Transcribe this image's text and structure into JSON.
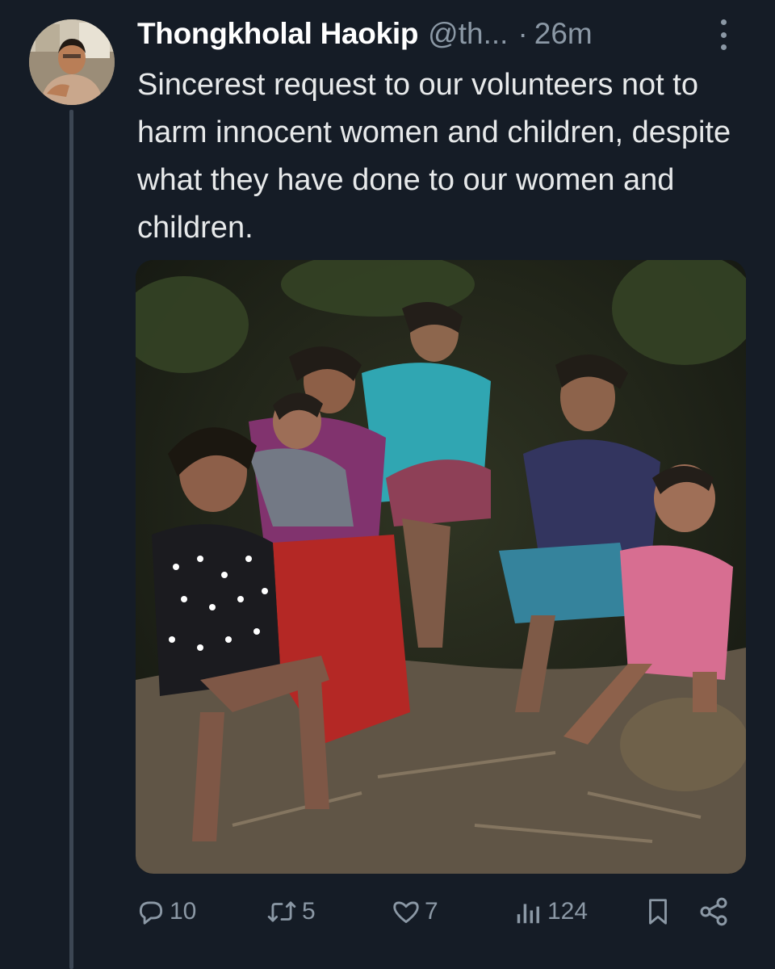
{
  "tweet": {
    "author_name": "Thongkholal Haokip",
    "handle": "@th...",
    "separator": "·",
    "time": "26m",
    "text": "Sincerest request to our volunteers not to harm innocent women and children, despite what they have done to our women and children."
  },
  "actions": {
    "replies": "10",
    "retweets": "5",
    "likes": "7",
    "views": "124"
  },
  "icons": [
    "more-icon",
    "reply-icon",
    "retweet-icon",
    "like-icon",
    "views-icon",
    "bookmark-icon",
    "share-icon"
  ],
  "colors": {
    "background": "#151c26",
    "text": "#e7e9ea",
    "muted": "#8b98a5"
  }
}
